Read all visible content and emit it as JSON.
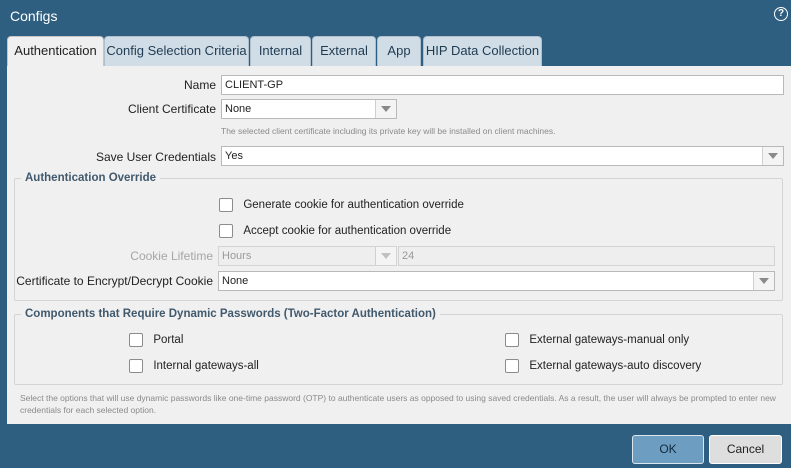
{
  "window": {
    "title": "Configs"
  },
  "tabs": [
    {
      "label": "Authentication",
      "active": true
    },
    {
      "label": "Config Selection Criteria",
      "active": false
    },
    {
      "label": "Internal",
      "active": false
    },
    {
      "label": "External",
      "active": false
    },
    {
      "label": "App",
      "active": false
    },
    {
      "label": "HIP Data Collection",
      "active": false
    }
  ],
  "form": {
    "name": {
      "label": "Name",
      "value": "CLIENT-GP"
    },
    "client_certificate": {
      "label": "Client Certificate",
      "value": "None",
      "hint": "The selected client certificate including its private key will be installed on client machines."
    },
    "save_user_credentials": {
      "label": "Save User Credentials",
      "value": "Yes"
    }
  },
  "auth_override": {
    "legend": "Authentication Override",
    "generate_cookie": {
      "label": "Generate cookie for authentication override",
      "checked": false
    },
    "accept_cookie": {
      "label": "Accept cookie for authentication override",
      "checked": false
    },
    "cookie_lifetime": {
      "label": "Cookie Lifetime",
      "unit": "Hours",
      "value": "24"
    },
    "certificate": {
      "label": "Certificate to Encrypt/Decrypt Cookie",
      "value": "None"
    }
  },
  "dynamic_passwords": {
    "legend": "Components that Require Dynamic Passwords (Two-Factor Authentication)",
    "portal": {
      "label": "Portal",
      "checked": false
    },
    "internal_all": {
      "label": "Internal gateways-all",
      "checked": false
    },
    "external_manual": {
      "label": "External gateways-manual only",
      "checked": false
    },
    "external_auto": {
      "label": "External gateways-auto discovery",
      "checked": false
    }
  },
  "note": "Select the options that will use dynamic passwords like one-time password (OTP) to authenticate users as opposed to using saved credentials. As a result, the user will always be prompted to enter new credentials for each selected option.",
  "buttons": {
    "ok": "OK",
    "cancel": "Cancel"
  },
  "colors": {
    "title_bar": "#2e5f80",
    "ok_button": "#6d9ec1",
    "legend_text": "#41596d"
  }
}
